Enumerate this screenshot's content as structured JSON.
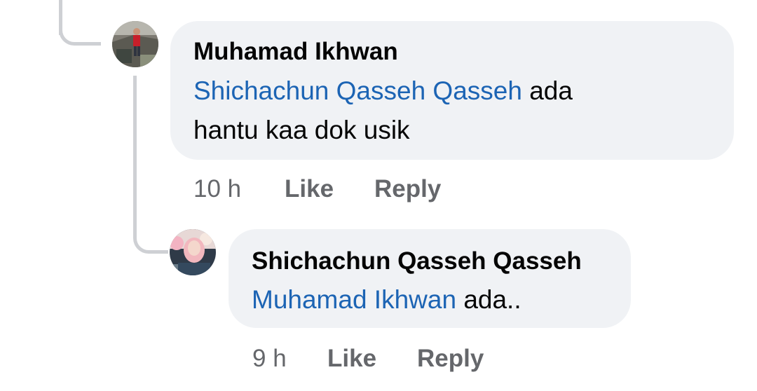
{
  "comments": [
    {
      "author": "Muhamad Ikhwan",
      "mention": "Shichachun Qasseh Qasseh",
      "text_line1_rest": " ada",
      "text_line2": "hantu kaa dok usik",
      "time": "10 h",
      "like_label": "Like",
      "reply_label": "Reply"
    },
    {
      "author": "Shichachun Qasseh Qasseh",
      "mention": "Muhamad Ikhwan",
      "text_rest": " ada..",
      "time": "9 h",
      "like_label": "Like",
      "reply_label": "Reply"
    }
  ],
  "colors": {
    "bubble": "#f0f2f5",
    "mention": "#1c64b4",
    "meta": "#65676b",
    "thread_line": "#ced0d4"
  }
}
